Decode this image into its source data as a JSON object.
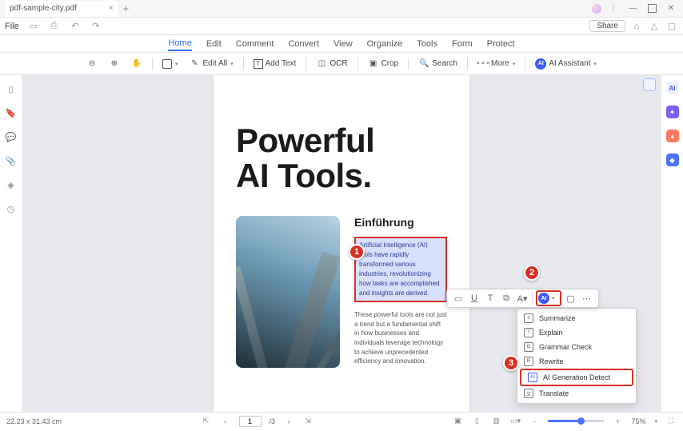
{
  "titlebar": {
    "tab": "pdf-sample-city.pdf"
  },
  "file_label": "File",
  "share_label": "Share",
  "menu": {
    "home": "Home",
    "edit": "Edit",
    "comment": "Comment",
    "convert": "Convert",
    "view": "View",
    "organize": "Organize",
    "tools": "Tools",
    "form": "Form",
    "protect": "Protect"
  },
  "toolbar": {
    "edit_all": "Edit All",
    "add_text": "Add Text",
    "ocr": "OCR",
    "crop": "Crop",
    "search": "Search",
    "more": "More",
    "ai": "AI Assistant"
  },
  "doc": {
    "title1": "Powerful",
    "title2": "AI Tools.",
    "subtitle": "Einführung",
    "highlight": "Artificial Intelligence (AI) tools have rapidly transformed various industries, revolutionizing how tasks are accomplished and insights are derived.",
    "para2": "These powerful tools are not just a trend but a fundamental shift in how businesses and individuals leverage technology to achieve unprecedented efficiency and innovation."
  },
  "dropdown": {
    "summarize": "Summarize",
    "explain": "Explain",
    "grammar": "Grammar Check",
    "rewrite": "Rewrite",
    "detect": "AI Generation Detect",
    "translate": "Translate"
  },
  "status": {
    "dims": "22.23 x 31.43 cm",
    "page": "1",
    "pages": "/3",
    "zoom": "75%"
  },
  "badges": {
    "one": "1",
    "two": "2",
    "three": "3"
  }
}
